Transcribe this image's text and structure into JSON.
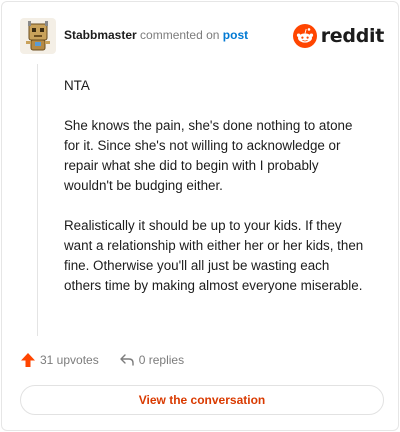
{
  "header": {
    "username": "Stabbmaster",
    "action_text": "commented on",
    "post_link": "post",
    "brand": "reddit"
  },
  "comment": {
    "paragraphs": [
      "NTA",
      "She knows the pain, she's done nothing to atone for it. Since she's not willing to acknowledge or repair what she did to begin with I probably wouldn't be budging either.",
      "Realistically it should be up to your kids. If they want a relationship with either her or her kids, then fine. Otherwise you'll all just be wasting each others time by making almost everyone miserable."
    ]
  },
  "actions": {
    "upvotes": "31 upvotes",
    "replies": "0 replies"
  },
  "cta": {
    "label": "View the conversation"
  },
  "colors": {
    "accent": "#d93a00",
    "link": "#0079d3",
    "upvote": "#ff4500"
  },
  "icons": {
    "avatar": "snoo-avatar-icon",
    "brand": "reddit-logo-icon",
    "upvote": "upvote-arrow-icon",
    "reply": "reply-arrow-icon"
  }
}
